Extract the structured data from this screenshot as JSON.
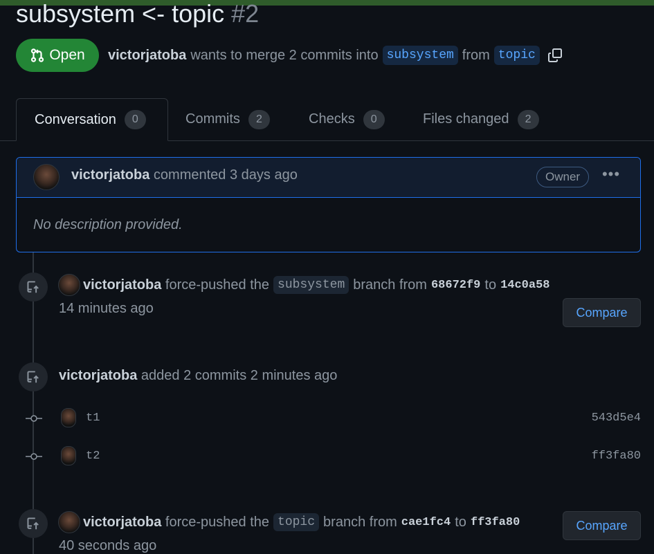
{
  "pr": {
    "title": "subsystem <- topic",
    "number": "#2",
    "state": "Open",
    "author": "victorjatoba",
    "merge_text": "wants to merge 2 commits into",
    "base_branch": "subsystem",
    "from_text": "from",
    "head_branch": "topic"
  },
  "tabs": [
    {
      "label": "Conversation",
      "count": "0"
    },
    {
      "label": "Commits",
      "count": "2"
    },
    {
      "label": "Checks",
      "count": "0"
    },
    {
      "label": "Files changed",
      "count": "2"
    }
  ],
  "comment": {
    "author": "victorjatoba",
    "action": "commented 3 days ago",
    "role": "Owner",
    "menu": "•••",
    "body": "No description provided."
  },
  "timeline": {
    "e1": {
      "author": "victorjatoba",
      "text1": "force-pushed the",
      "branch": "subsystem",
      "text2": "branch from",
      "from_sha": "68672f9",
      "to_text": "to",
      "to_sha": "14c0a58",
      "time": "14 minutes ago",
      "button": "Compare"
    },
    "e2": {
      "author": "victorjatoba",
      "text": "added 2 commits 2 minutes ago"
    },
    "commits": [
      {
        "message": "t1",
        "sha": "543d5e4"
      },
      {
        "message": "t2",
        "sha": "ff3fa80"
      }
    ],
    "e3": {
      "author": "victorjatoba",
      "text1": "force-pushed the",
      "branch": "topic",
      "text2": "branch from",
      "from_sha": "cae1fc4",
      "to_text": "to",
      "to_sha": "ff3fa80",
      "time": "40 seconds ago",
      "button": "Compare"
    }
  },
  "icons": {
    "state": "git-pull-request-icon",
    "copy": "copy-icon",
    "push": "repo-push-icon",
    "commit": "git-commit-icon"
  },
  "colors": {
    "background": "#0d1117",
    "open_green": "#238636",
    "accent_blue": "#58a6ff",
    "muted": "#8d96a0"
  }
}
